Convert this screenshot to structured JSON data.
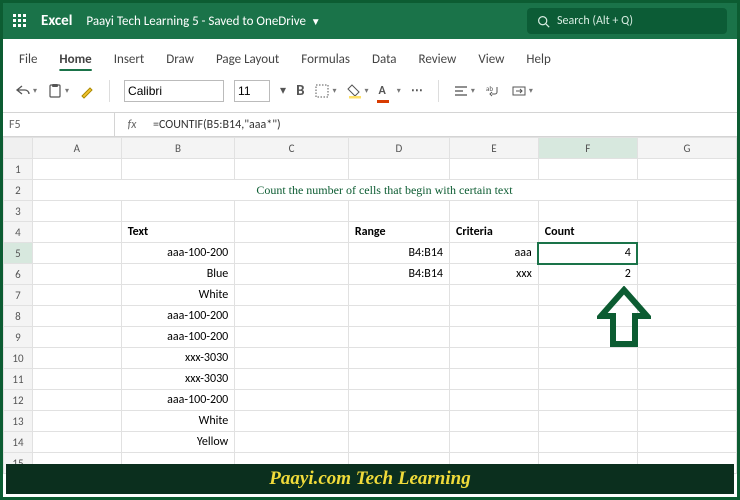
{
  "title": {
    "app": "Excel",
    "doc": "Paayi Tech Learning 5",
    "state": "Saved to OneDrive"
  },
  "search": {
    "placeholder": "Search (Alt + Q)"
  },
  "tabs": [
    "File",
    "Home",
    "Insert",
    "Draw",
    "Page Layout",
    "Formulas",
    "Data",
    "Review",
    "View",
    "Help"
  ],
  "activeTab": "Home",
  "font": {
    "name": "Calibri",
    "size": "11"
  },
  "namebox": "F5",
  "fx": "fx",
  "formula": "=COUNTIF(B5:B14,\"aaa*\")",
  "cols": [
    "A",
    "B",
    "C",
    "D",
    "E",
    "F",
    "G"
  ],
  "rows": [
    "1",
    "2",
    "3",
    "4",
    "5",
    "6",
    "7",
    "8",
    "9",
    "10",
    "11",
    "12",
    "13",
    "14",
    "15"
  ],
  "sheetTitle": "Count the number of cells that begin with certain text",
  "head": {
    "text": "Text",
    "range": "Range",
    "criteria": "Criteria",
    "count": "Count"
  },
  "data": {
    "b": [
      "aaa-100-200",
      "Blue",
      "White",
      "aaa-100-200",
      "aaa-100-200",
      "xxx-3030",
      "xxx-3030",
      "aaa-100-200",
      "White",
      "Yellow"
    ],
    "d5": "B4:B14",
    "d6": "B4:B14",
    "e5": "aaa",
    "e6": "xxx",
    "f5": "4",
    "f6": "2"
  },
  "footer": "Paayi.com Tech Learning"
}
